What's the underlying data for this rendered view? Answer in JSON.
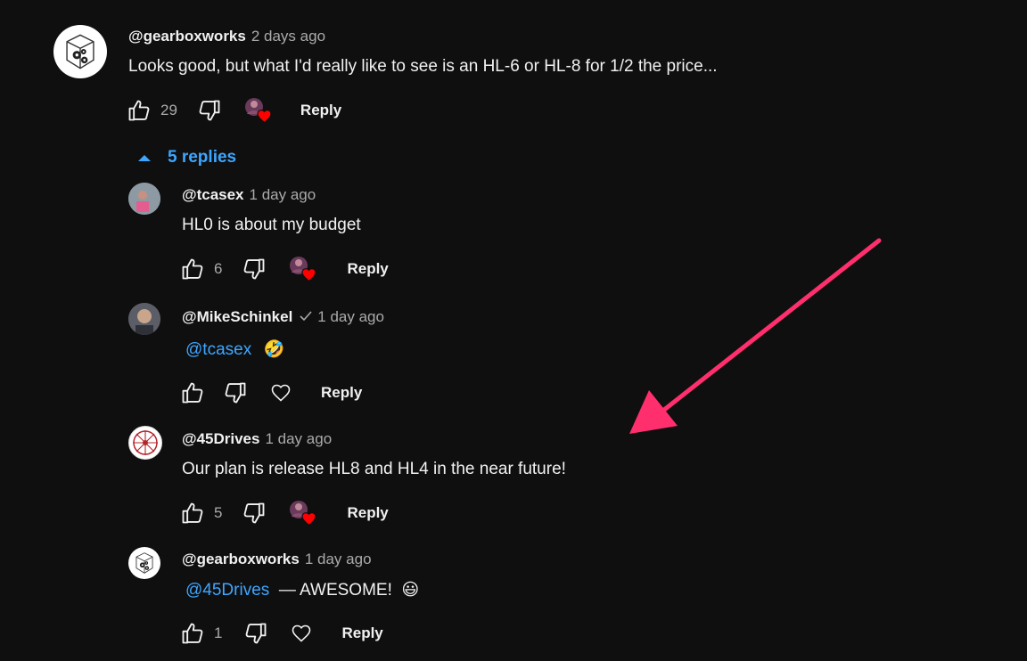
{
  "top_comment": {
    "handle": "@gearboxworks",
    "time": "2 days ago",
    "text": "Looks good, but what I'd really like to see is an HL-6 or HL-8 for 1/2 the price...",
    "likes": "29",
    "reply_label": "Reply"
  },
  "replies_toggle": {
    "label": "5 replies",
    "color": "#3ea6ff"
  },
  "replies": [
    {
      "handle": "@tcasex",
      "time": "1 day ago",
      "text": "HL0 is about my budget",
      "likes": "6",
      "reply_label": "Reply",
      "creator_heart": true
    },
    {
      "handle": "@MikeSchinkel",
      "time": "1 day ago",
      "mention": "@tcasex",
      "text": "",
      "emoji": "🤣",
      "likes": "",
      "reply_label": "Reply",
      "verified": true,
      "creator_heart": false
    },
    {
      "handle": "@45Drives",
      "time": "1 day ago",
      "text": "Our plan is release HL8 and HL4 in the near future!",
      "likes": "5",
      "reply_label": "Reply",
      "creator_heart": true
    },
    {
      "handle": "@gearboxworks",
      "time": "1 day ago",
      "mention": "@45Drives",
      "text": " — AWESOME! ",
      "emoji": "😃",
      "likes": "1",
      "reply_label": "Reply",
      "creator_heart": false
    }
  ],
  "colors": {
    "background": "#0f0f0f",
    "text": "#f1f1f1",
    "secondary": "#aaaaaa",
    "link": "#3ea6ff",
    "heart": "#ff0000",
    "annotation_arrow": "#ff2f6e"
  },
  "icons": [
    "thumbs-up-icon",
    "thumbs-down-icon",
    "heart-icon",
    "creator-heart-icon",
    "chevron-up-icon",
    "checkmark-icon",
    "gears-icon",
    "annotation-arrow"
  ]
}
